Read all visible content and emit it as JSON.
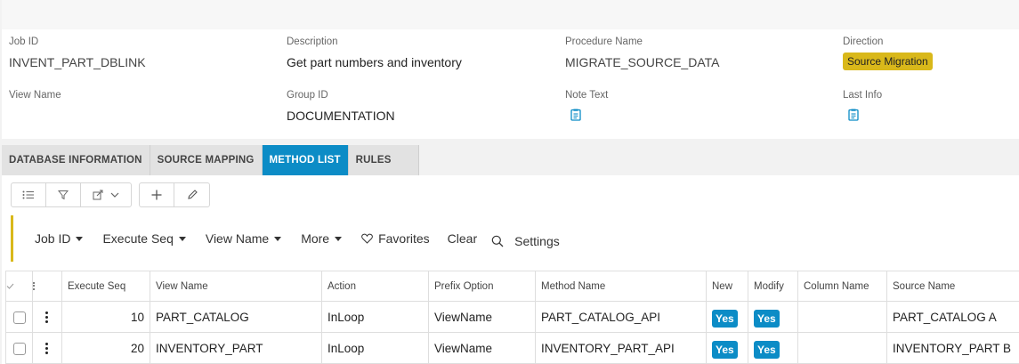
{
  "header": {
    "fields": {
      "job_id": {
        "label": "Job ID",
        "value": "INVENT_PART_DBLINK"
      },
      "description": {
        "label": "Description",
        "value": "Get part numbers and inventory"
      },
      "procedure_name": {
        "label": "Procedure Name",
        "value": "MIGRATE_SOURCE_DATA"
      },
      "direction": {
        "label": "Direction",
        "value": "Source Migration"
      },
      "view_name": {
        "label": "View Name",
        "value": ""
      },
      "group_id": {
        "label": "Group ID",
        "value": "DOCUMENTATION"
      },
      "note_text": {
        "label": "Note Text",
        "icon": "note-icon"
      },
      "last_info": {
        "label": "Last Info",
        "icon": "note-icon"
      }
    }
  },
  "tabs": [
    {
      "label": "DATABASE INFORMATION",
      "active": false
    },
    {
      "label": "SOURCE MAPPING",
      "active": false
    },
    {
      "label": "METHOD LIST",
      "active": true
    },
    {
      "label": "RULES",
      "active": false
    }
  ],
  "toolbar": {
    "icons": [
      "list-icon",
      "filter-icon",
      "export-icon",
      "chevron-down-icon",
      "add-icon",
      "edit-icon"
    ]
  },
  "filterbar": {
    "items": [
      "Job ID",
      "Execute Seq",
      "View Name",
      "More"
    ],
    "favorites": "Favorites",
    "clear": "Clear",
    "settings": "Settings"
  },
  "grid": {
    "columns": [
      "Execute Seq",
      "View Name",
      "Action",
      "Prefix Option",
      "Method Name",
      "New",
      "Modify",
      "Column Name",
      "Source Name"
    ],
    "rows": [
      {
        "execute_seq": "10",
        "view_name": "PART_CATALOG",
        "action": "InLoop",
        "prefix_option": "ViewName",
        "method_name": "PART_CATALOG_API",
        "new": "Yes",
        "modify": "Yes",
        "column_name": "",
        "source_name": "PART_CATALOG A"
      },
      {
        "execute_seq": "20",
        "view_name": "INVENTORY_PART",
        "action": "InLoop",
        "prefix_option": "ViewName",
        "method_name": "INVENTORY_PART_API",
        "new": "Yes",
        "modify": "Yes",
        "column_name": "",
        "source_name": "INVENTORY_PART B"
      }
    ]
  },
  "colors": {
    "accent": "#0c8cc6",
    "badge": "#d9b81a"
  }
}
